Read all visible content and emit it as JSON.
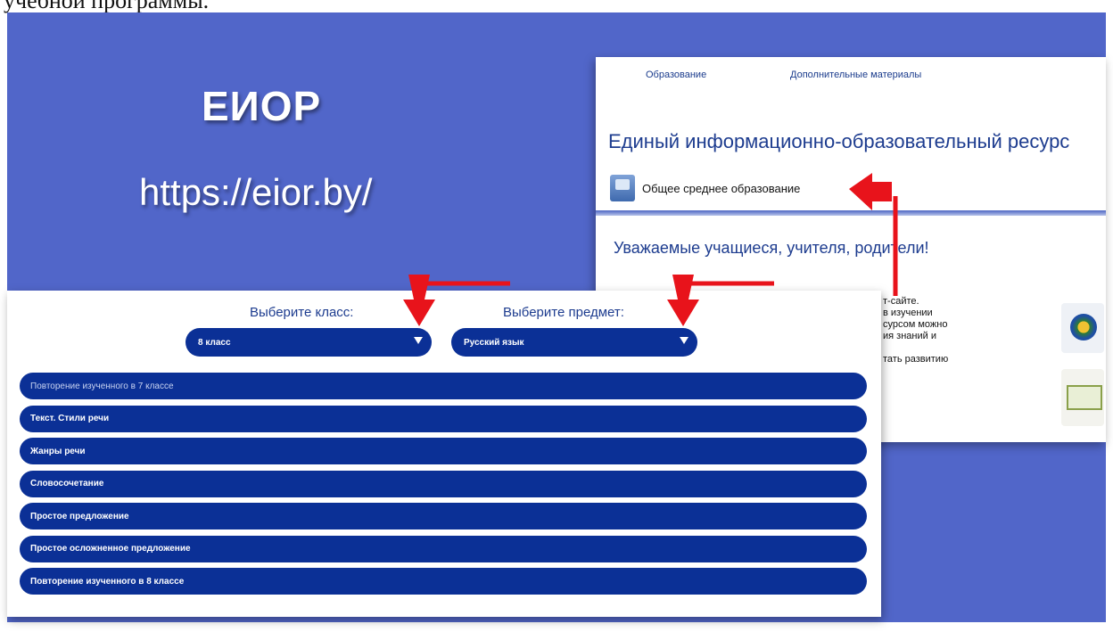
{
  "page_top_text": "учебной программы.",
  "slide": {
    "title": "ЕИОР",
    "url": "https://eior.by/"
  },
  "site_screenshot": {
    "nav": [
      "Образование",
      "Дополнительные материалы"
    ],
    "site_title": "Единый информационно-образовательный ресурс",
    "section_label": "Общее среднее образование",
    "greeting": "Уважаемые учащиеся, учителя, родители!",
    "snippet_lines": [
      "т-сайте.",
      "в изучении",
      "сурсом можно",
      "ия знаний и",
      "",
      "тать развитию"
    ]
  },
  "selector_screenshot": {
    "class_label": "Выберите класс:",
    "class_value": "8 класс",
    "subject_label": "Выберите предмет:",
    "subject_value": "Русский язык",
    "topics": [
      "Повторение изученного в 7 классе",
      "Текст. Стили речи",
      "Жанры речи",
      "Словосочетание",
      "Простое предложение",
      "Простое осложненное предложение",
      "Повторение изученного в 8 классе"
    ]
  },
  "colors": {
    "slide_bg": "#5166c9",
    "button_blue": "#0b3096",
    "arrow_red": "#e8131b"
  }
}
